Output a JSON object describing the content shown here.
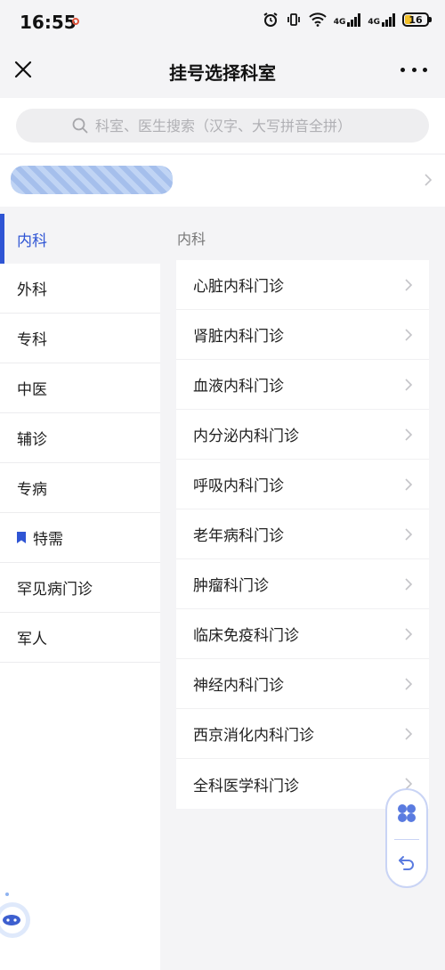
{
  "status_bar": {
    "time": "16:55",
    "network_1": "4G",
    "network_2": "4G",
    "battery": "16"
  },
  "header": {
    "title": "挂号选择科室"
  },
  "search": {
    "placeholder": "科室、医生搜索（汉字、大写拼音全拼）"
  },
  "left_nav": {
    "items": [
      "内科",
      "外科",
      "专科",
      "中医",
      "辅诊",
      "专病",
      "特需",
      "罕见病门诊",
      "军人"
    ],
    "active_index": 0
  },
  "right_panel": {
    "section_title": "内科",
    "departments": [
      "心脏内科门诊",
      "肾脏内科门诊",
      "血液内科门诊",
      "内分泌内科门诊",
      "呼吸内科门诊",
      "老年病科门诊",
      "肿瘤科门诊",
      "临床免疫科门诊",
      "神经内科门诊",
      "西京消化内科门诊",
      "全科医学科门诊"
    ]
  },
  "colors": {
    "accent": "#2f55d4",
    "background": "#f4f4f6",
    "card": "#ffffff",
    "text": "#1f1f1f",
    "muted": "#777777"
  },
  "icons": {
    "close": "close-icon",
    "more": "more-dots-icon",
    "search": "search-icon",
    "chevron": "chevron-right-icon",
    "bookmark": "bookmark-icon",
    "grid": "grid-icon",
    "back": "back-arrow-icon"
  }
}
